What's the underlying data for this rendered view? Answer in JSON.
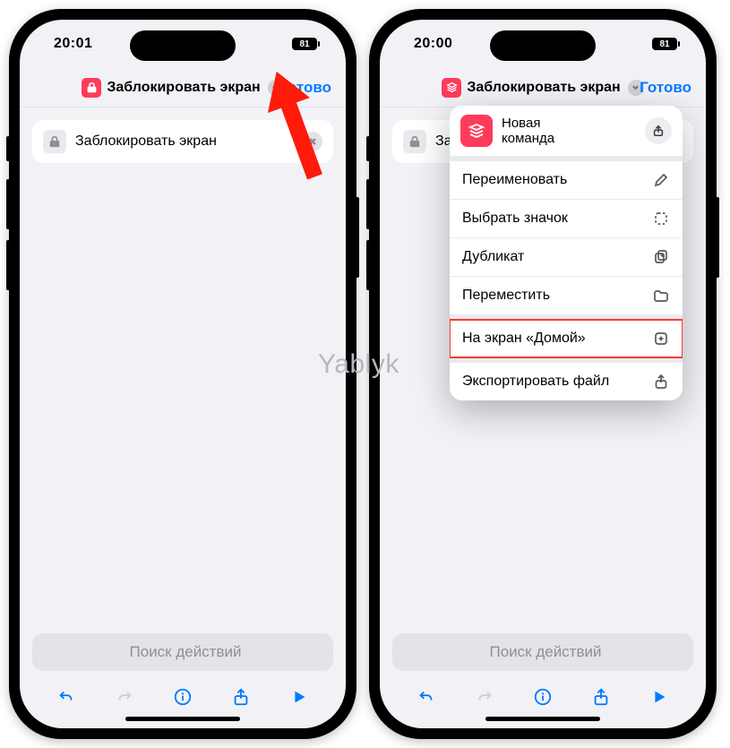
{
  "status": {
    "time_left": "20:01",
    "time_right": "20:00",
    "battery": "81"
  },
  "nav": {
    "title": "Заблокировать экран",
    "done": "Готово"
  },
  "card": {
    "label": "Заблокировать экран"
  },
  "search": {
    "placeholder": "Поиск действий"
  },
  "dropdown": {
    "head": "Новая\nкоманда",
    "items": [
      {
        "label": "Переименовать",
        "icon": "pencil"
      },
      {
        "label": "Выбрать значок",
        "icon": "dashed-square"
      },
      {
        "label": "Дубликат",
        "icon": "duplicate"
      },
      {
        "label": "Переместить",
        "icon": "folder"
      }
    ],
    "home": {
      "label": "На экран «Домой»",
      "icon": "add-square"
    },
    "export": {
      "label": "Экспортировать файл",
      "icon": "share"
    }
  },
  "watermark": "Yablyk",
  "colors": {
    "accent": "#007aff",
    "shortcut_red": "#ff3b5b",
    "highlight": "#ff3a2f"
  }
}
